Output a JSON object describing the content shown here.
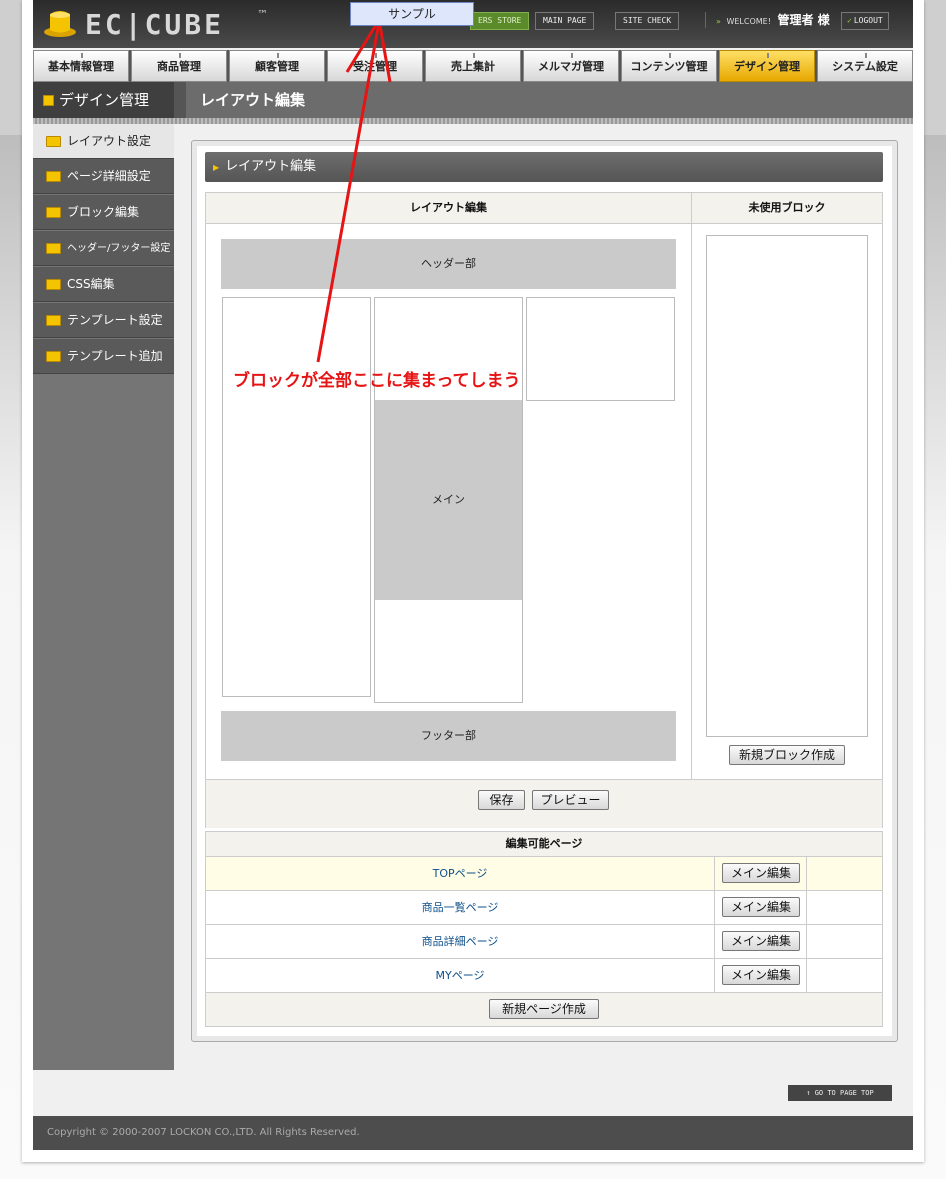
{
  "header": {
    "logo_text": "EC|CUBE",
    "logo_tm": "™",
    "store_label": "ERS STORE",
    "main_page_label": "MAIN PAGE",
    "site_check_label": "SITE CHECK",
    "welcome_label": "WELCOME!",
    "user_name": "管理者 様",
    "logout_label": "LOGOUT"
  },
  "popup": {
    "text": "サンプル"
  },
  "nav": {
    "tabs": [
      "基本情報管理",
      "商品管理",
      "顧客管理",
      "受注管理",
      "売上集計",
      "メルマガ管理",
      "コンテンツ管理",
      "デザイン管理",
      "システム設定"
    ],
    "active": "デザイン管理"
  },
  "subheader": {
    "section": "デザイン管理",
    "page": "レイアウト編集"
  },
  "sidebar": {
    "items": [
      "レイアウト設定",
      "ページ詳細設定",
      "ブロック編集",
      "ヘッダー/フッター設定",
      "CSS編集",
      "テンプレート設定",
      "テンプレート追加"
    ],
    "active": "レイアウト設定"
  },
  "layout": {
    "section_title": "レイアウト編集",
    "edit_header": "レイアウト編集",
    "unused_header": "未使用ブロック",
    "header_block": "ヘッダー部",
    "main_block": "メイン",
    "footer_block": "フッター部",
    "new_block_button": "新規ブロック作成",
    "save_button": "保存",
    "preview_button": "プレビュー"
  },
  "pages": {
    "header": "編集可能ページ",
    "rows": [
      {
        "name": "TOPページ",
        "button": "メイン編集"
      },
      {
        "name": "商品一覧ページ",
        "button": "メイン編集"
      },
      {
        "name": "商品詳細ページ",
        "button": "メイン編集"
      },
      {
        "name": "MYページ",
        "button": "メイン編集"
      }
    ],
    "new_page_button": "新規ページ作成"
  },
  "annotation": {
    "text": "ブロックが全部ここに集まってしまう",
    "color": "#e61414"
  },
  "footer": {
    "page_top": "GO TO PAGE TOP",
    "copyright": "Copyright © 2000-2007 LOCKON CO.,LTD. All Rights Reserved."
  },
  "colors": {
    "accent": "#f5c400",
    "link": "#0d4f8a",
    "highlight_row": "#fffde6"
  }
}
